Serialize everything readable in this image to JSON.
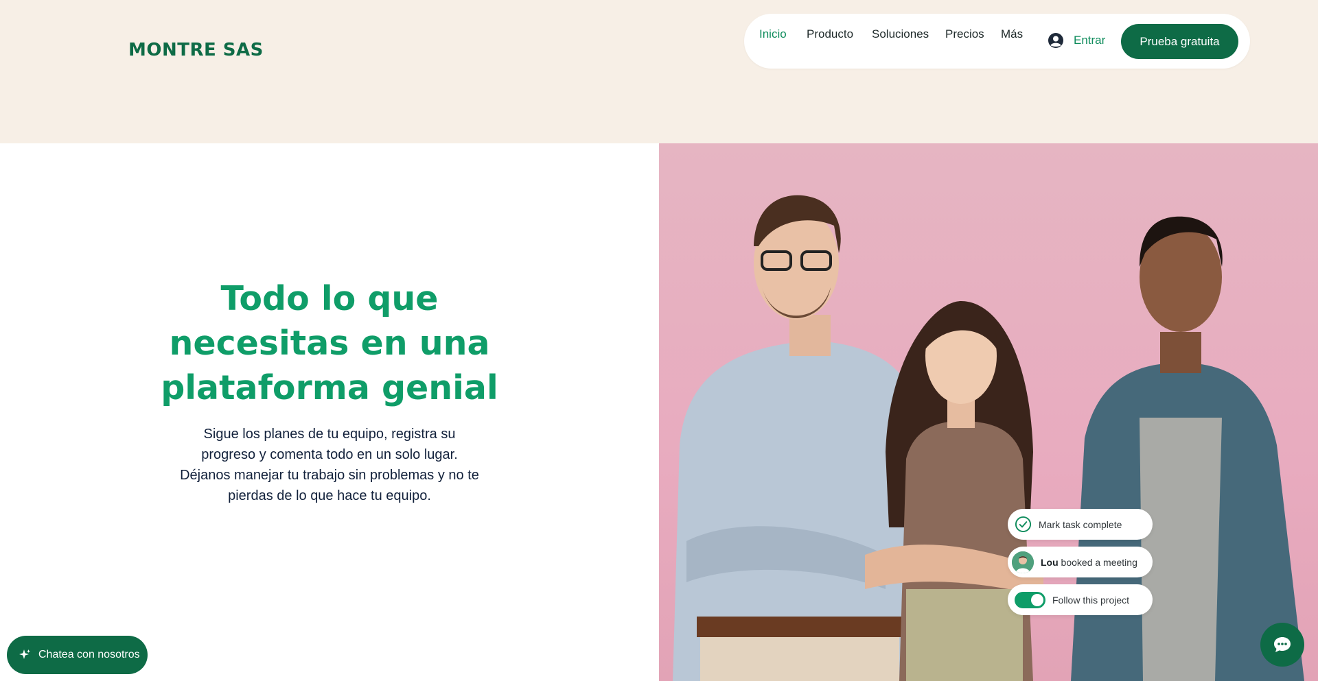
{
  "brand": {
    "name": "MONTRE SAS"
  },
  "nav": {
    "items": [
      {
        "label": "Inicio",
        "active": true
      },
      {
        "label": "Producto"
      },
      {
        "label": "Soluciones"
      },
      {
        "label": "Precios"
      },
      {
        "label": "Más"
      }
    ],
    "login_label": "Entrar",
    "cta_label": "Prueba gratuita"
  },
  "hero": {
    "title_lines": [
      "Todo lo que",
      "necesitas en una",
      "plataforma genial"
    ],
    "subtitle_lines": [
      "Sigue los planes de tu equipo, registra su",
      "progreso y comenta todo en un solo lugar.",
      "Déjanos manejar tu trabajo sin problemas y no te",
      "pierdas de lo que hace tu equipo."
    ]
  },
  "notifications": {
    "task": "Mark task complete",
    "meeting_name": "Lou",
    "meeting_text": " booked a meeting",
    "follow": "Follow this project"
  },
  "chat": {
    "label": "Chatea con nosotros"
  },
  "colors": {
    "brand_green": "#0e6b46",
    "accent_green": "#0f9d68",
    "header_bg": "#f7efe6",
    "hero_bg_pink": "#e6b5c2"
  },
  "icons": {
    "login": "user-circle-icon",
    "task": "check-circle-icon",
    "chat_pill": "sparkle-icon",
    "chat_circle": "chat-bubble-icon"
  }
}
